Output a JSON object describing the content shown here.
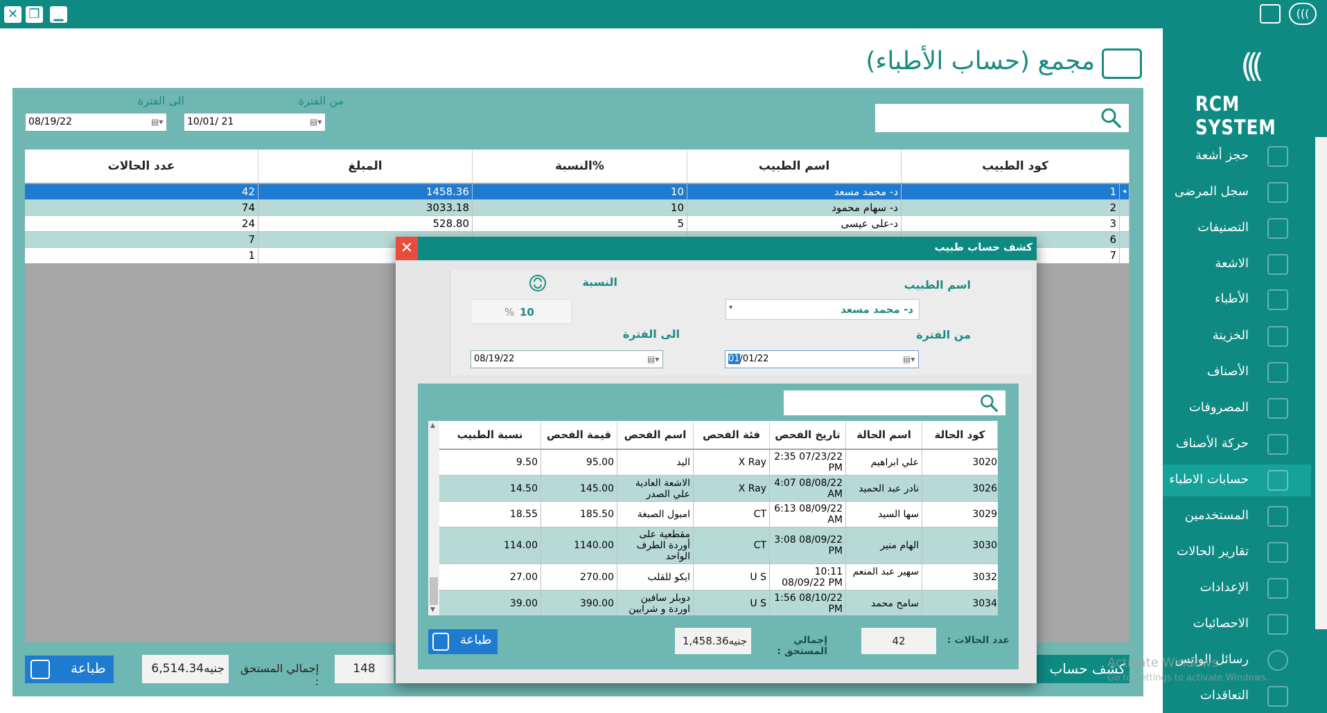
{
  "window": {
    "controls": [
      "close",
      "restore",
      "minimize"
    ]
  },
  "brand": {
    "name": "RCM SYSTEM"
  },
  "sidebar": {
    "items": [
      {
        "label": "حجز أشعة"
      },
      {
        "label": "سجل المرضى"
      },
      {
        "label": "التصنيفات"
      },
      {
        "label": "الاشعة"
      },
      {
        "label": "الأطباء"
      },
      {
        "label": "الخزينة"
      },
      {
        "label": "الأصناف"
      },
      {
        "label": "المصروفات"
      },
      {
        "label": "حركة الأصناف"
      },
      {
        "label": "حسابات الاطباء",
        "active": true
      },
      {
        "label": "المستخدمين"
      },
      {
        "label": "تقارير الحالات"
      },
      {
        "label": "الإعدادات"
      },
      {
        "label": "الاحصائيات"
      },
      {
        "label": "رسائل الواتس"
      },
      {
        "label": "التعاقدات"
      }
    ]
  },
  "main": {
    "title": "مجمع (حساب الأطباء)",
    "from_label": "من الفترة",
    "to_label": "الى الفترة",
    "from_date": "10/01/ 21",
    "to_date": "08/19/22",
    "search_placeholder": "",
    "columns": [
      "كود الطبيب",
      "اسم الطبيب",
      "النسبة%",
      "المبلغ",
      "عدد الحالات"
    ],
    "rows": [
      {
        "code": "1",
        "name": "د- محمد مسعد",
        "pct": "10",
        "amount": "1458.36",
        "cases": "42",
        "selected": true
      },
      {
        "code": "2",
        "name": "د- سهام محمود",
        "pct": "10",
        "amount": "3033.18",
        "cases": "74"
      },
      {
        "code": "3",
        "name": "د-على عيسى",
        "pct": "5",
        "amount": "528.80",
        "cases": "24"
      },
      {
        "code": "6",
        "name": "",
        "pct": "",
        "amount": "",
        "cases": "7"
      },
      {
        "code": "7",
        "name": "",
        "pct": "",
        "amount": "",
        "cases": "1"
      }
    ],
    "print_label": "طباعة",
    "total_label": "إجمالي المستحق :",
    "total_value": "6,514.34جنيه",
    "cases_total": "148",
    "statement_button": "كشف حساب"
  },
  "dialog": {
    "title": "كشف حساب طبيب",
    "doctor_label": "اسم الطبيب",
    "doctor_value": "د- محمد مسعد",
    "ratio_label": "النسبة",
    "ratio_value": "10",
    "ratio_unit": "%",
    "from_label": "من الفترة",
    "to_label": "الى الفترة",
    "from_date_sel": "01",
    "from_date_rest": "/01/22",
    "to_date": "08/19/22",
    "columns": [
      "كود الحالة",
      "اسم الحالة",
      "تاريخ الفحص",
      "فئة الفحص",
      "اسم الفحص",
      "قيمة الفحص",
      "نسبة الطبيب"
    ],
    "rows": [
      {
        "code": "3020",
        "name": "علي ابراهيم",
        "date": "2:35 07/23/22 PM",
        "cat": "X Ray",
        "exam": "اليد",
        "value": "95.00",
        "share": "9.50"
      },
      {
        "code": "3026",
        "name": "نادر عبد الحميد",
        "date": "4:07 08/08/22 AM",
        "cat": "X Ray",
        "exam": "الاشعة العادية علي الصدر",
        "value": "145.00",
        "share": "14.50"
      },
      {
        "code": "3029",
        "name": "سها السيد",
        "date": "6:13 08/09/22 AM",
        "cat": "CT",
        "exam": "امبول الصبغة",
        "value": "185.50",
        "share": "18.55"
      },
      {
        "code": "3030",
        "name": "الهام منير",
        "date": "3:08 08/09/22 PM",
        "cat": "CT",
        "exam": "مقطعية على أوردة الطرف الواحد",
        "value": "1140.00",
        "share": "114.00"
      },
      {
        "code": "3032",
        "name": "سهير عبد المنعم",
        "date": "10:11 08/09/22 PM",
        "cat": "U S",
        "exam": "ايكو للقلب",
        "value": "270.00",
        "share": "27.00"
      },
      {
        "code": "3034",
        "name": "سامح محمد",
        "date": "1:56 08/10/22 PM",
        "cat": "U S",
        "exam": "دوبلر سافين اوردة و شرايين",
        "value": "390.00",
        "share": "39.00"
      }
    ],
    "print_label": "طباعة",
    "total_label": "إجمالي المستحق :",
    "total_value": "1,458.36جنيه",
    "cases_label": "عدد الحالات :",
    "cases_value": "42"
  },
  "watermark": {
    "line1": "Activate Windows",
    "line2": "Go to Settings to activate Windows."
  },
  "colors": {
    "teal": "#0e8a82",
    "panel": "#6fb7b2",
    "selected_row": "#1e7bd0",
    "alt_row": "#b7dad7",
    "close_red": "#e84c3d"
  }
}
